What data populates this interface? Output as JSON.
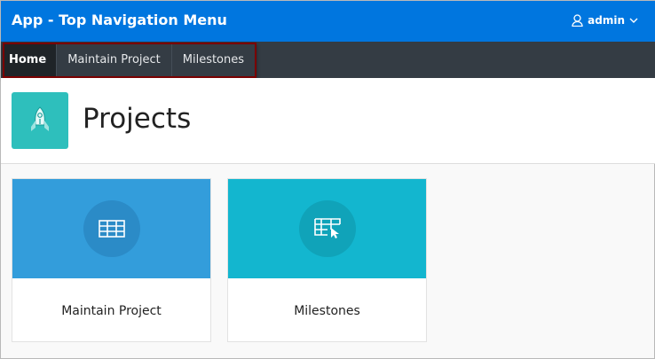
{
  "header": {
    "title": "App - Top Navigation Menu",
    "user": "admin"
  },
  "nav": {
    "items": [
      {
        "label": "Home"
      },
      {
        "label": "Maintain Project"
      },
      {
        "label": "Milestones"
      }
    ]
  },
  "page": {
    "title": "Projects"
  },
  "cards": [
    {
      "label": "Maintain Project",
      "color": "#339ddb"
    },
    {
      "label": "Milestones",
      "color": "#13b6cf"
    }
  ]
}
